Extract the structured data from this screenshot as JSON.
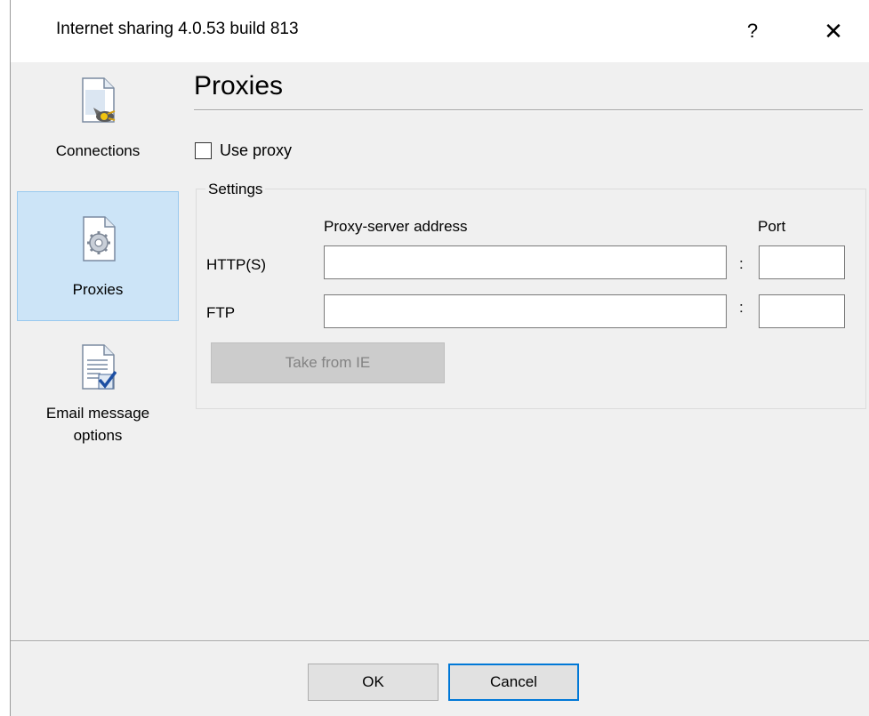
{
  "window": {
    "title": "Internet sharing 4.0.53 build 813",
    "help_glyph": "?",
    "close_glyph": "✕"
  },
  "sidebar": {
    "items": [
      {
        "label": "Connections",
        "icon": "connections-icon",
        "selected": false
      },
      {
        "label": "Proxies",
        "icon": "proxies-icon",
        "selected": true
      },
      {
        "label_line1": "Email message",
        "label_line2": "options",
        "icon": "email-options-icon",
        "selected": false
      }
    ]
  },
  "main": {
    "title": "Proxies",
    "use_proxy": {
      "label": "Use proxy",
      "checked": false
    },
    "settings": {
      "legend": "Settings",
      "address_header": "Proxy-server address",
      "port_header": "Port",
      "rows": [
        {
          "label": "HTTP(S)",
          "address": "",
          "separator": ":",
          "port": ""
        },
        {
          "label": "FTP",
          "address": "",
          "separator": ":",
          "port": ""
        }
      ],
      "take_from_ie": "Take from IE"
    }
  },
  "footer": {
    "ok_label": "OK",
    "cancel_label": "Cancel"
  },
  "colors": {
    "dialog_bg": "#f0f0f0",
    "selected_bg": "#cce4f7",
    "selected_border": "#99c9ef",
    "accent": "#0078d7"
  }
}
